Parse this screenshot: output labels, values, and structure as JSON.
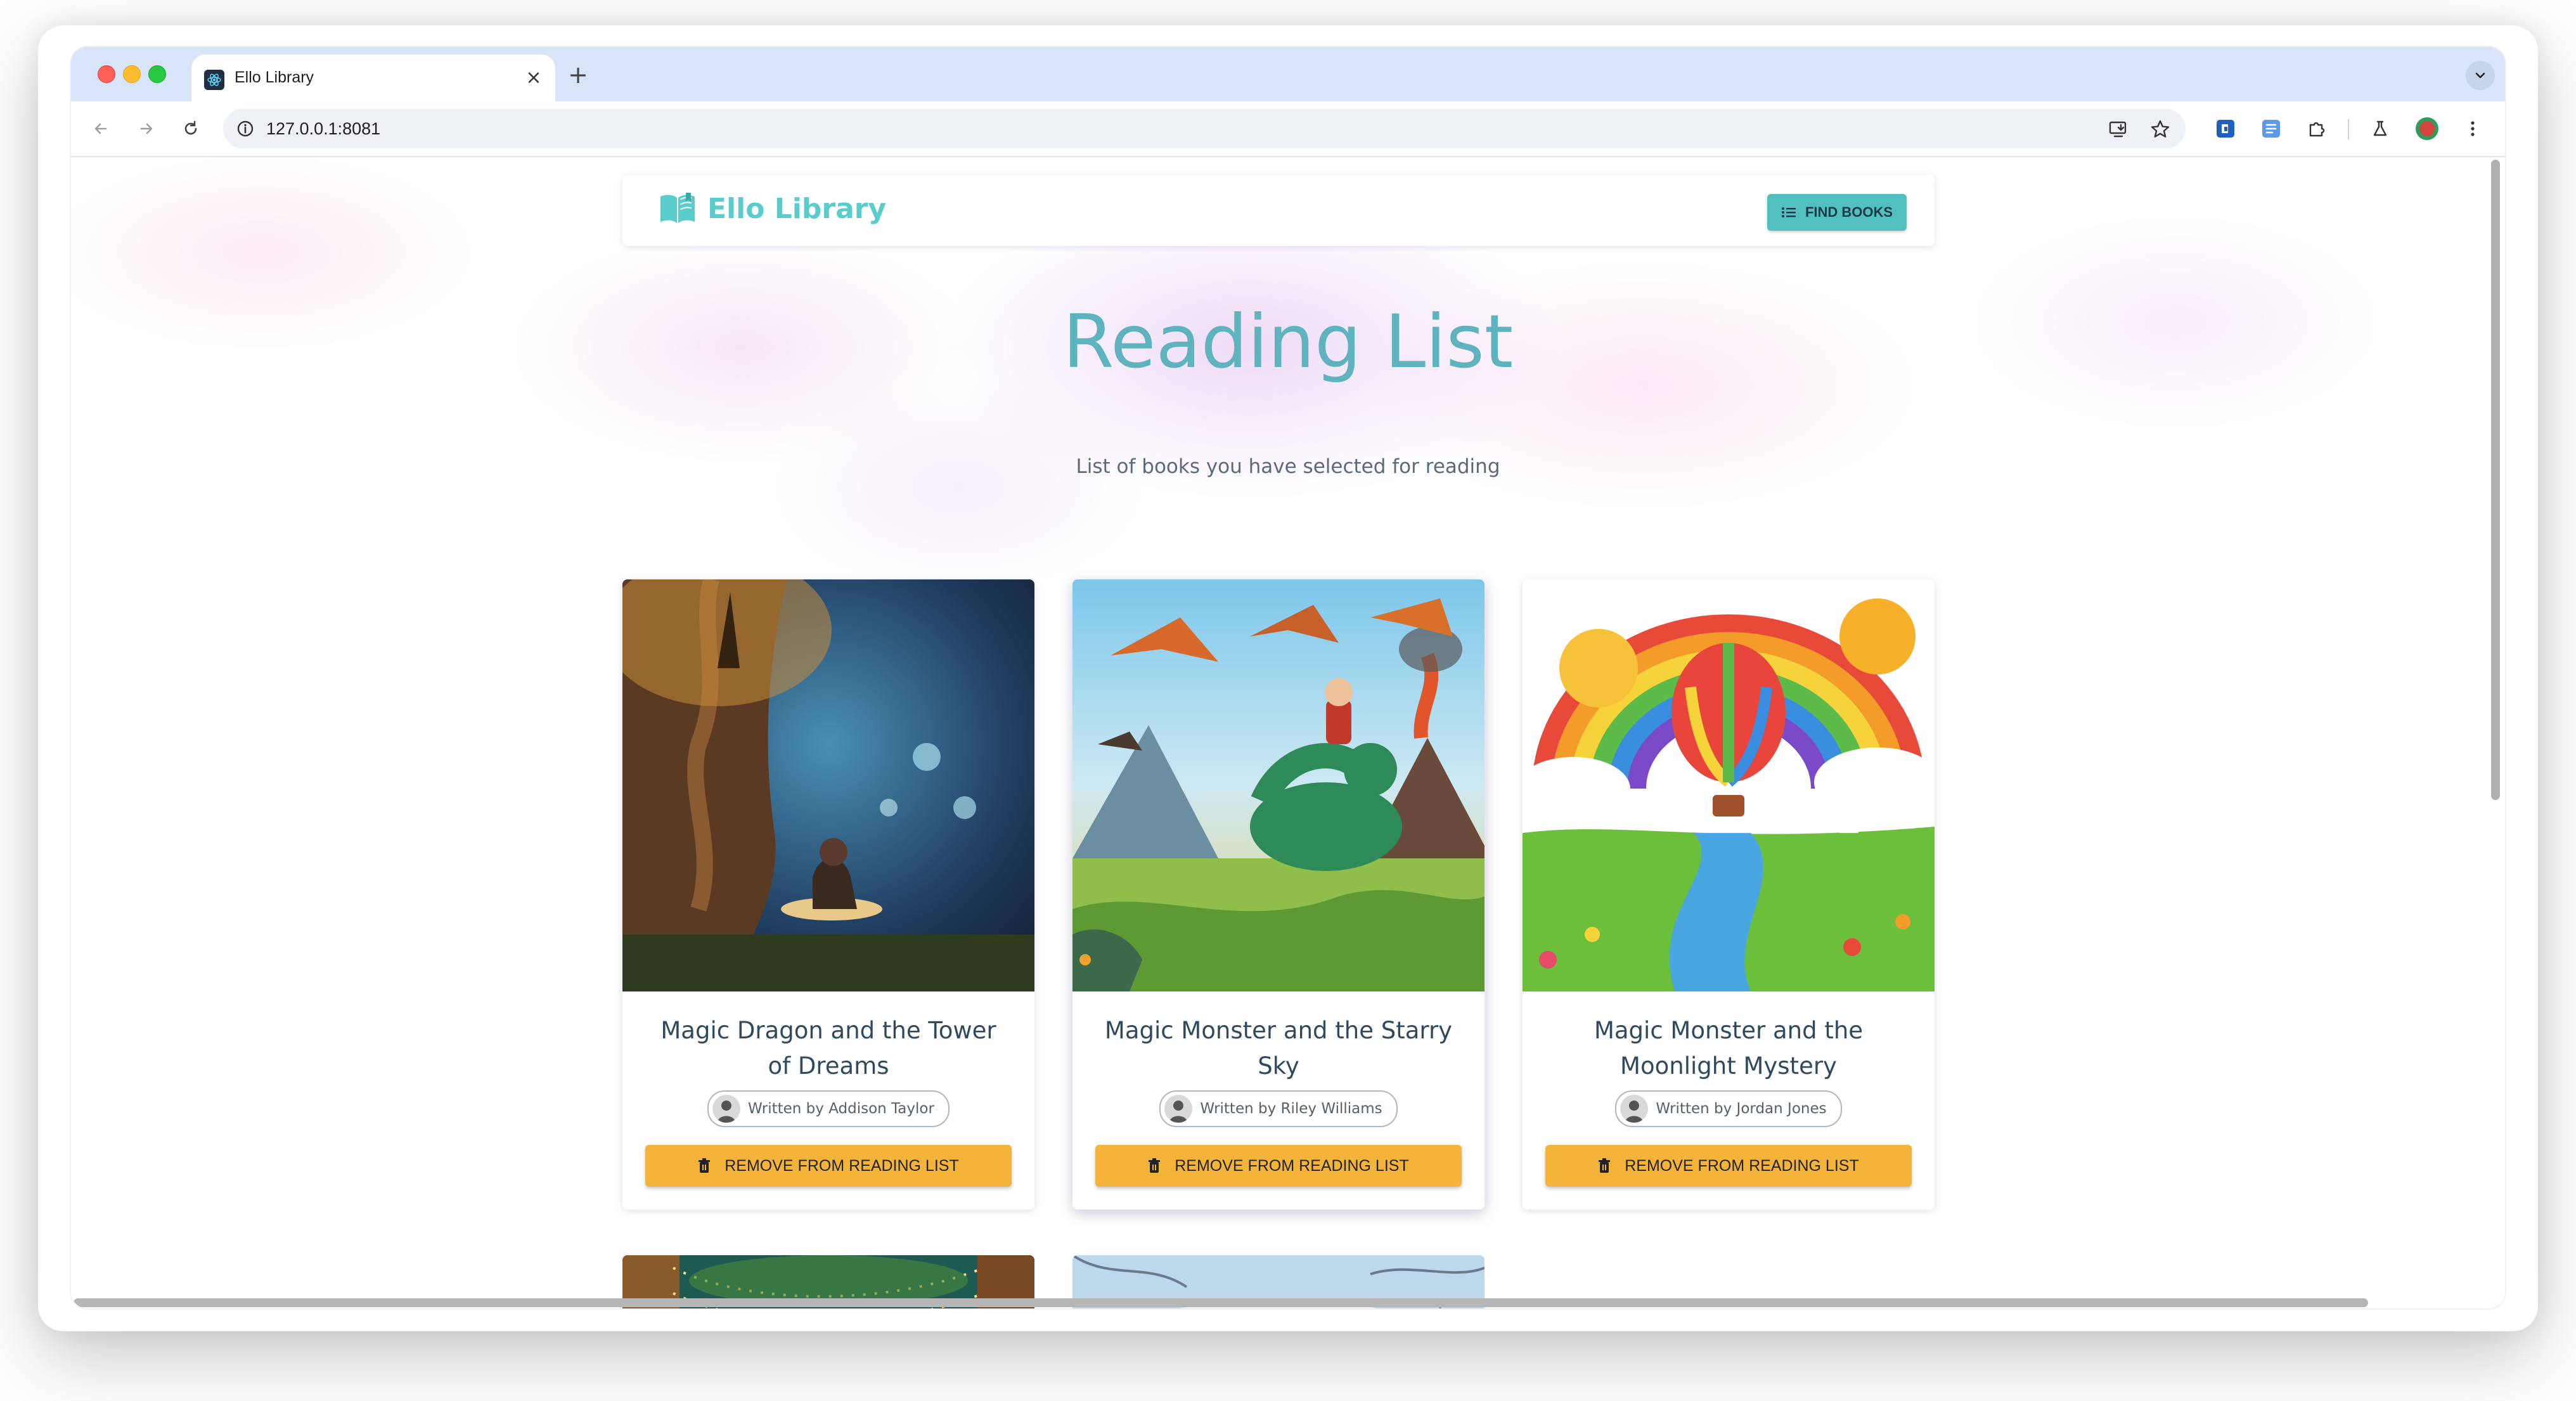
{
  "browser": {
    "tab_title": "Ello Library",
    "tab_close": "×",
    "new_tab": "+",
    "url": "127.0.0.1:8081"
  },
  "app": {
    "logo_text": "Ello Library",
    "find_books_label": "FIND BOOKS",
    "accent_color": "#5acccc",
    "button_color": "#f4b43a"
  },
  "page": {
    "title": "Reading List",
    "subtitle": "List of books you have selected for reading"
  },
  "books": [
    {
      "title": "Magic Dragon and the Tower of Dreams",
      "author": "Written by Addison Taylor",
      "button": "REMOVE FROM READING LIST"
    },
    {
      "title": "Magic Monster and the Starry Sky",
      "author": "Written by Riley Williams",
      "button": "REMOVE FROM READING LIST"
    },
    {
      "title": "Magic Monster and the Moonlight Mystery",
      "author": "Written by Jordan Jones",
      "button": "REMOVE FROM READING LIST"
    }
  ]
}
